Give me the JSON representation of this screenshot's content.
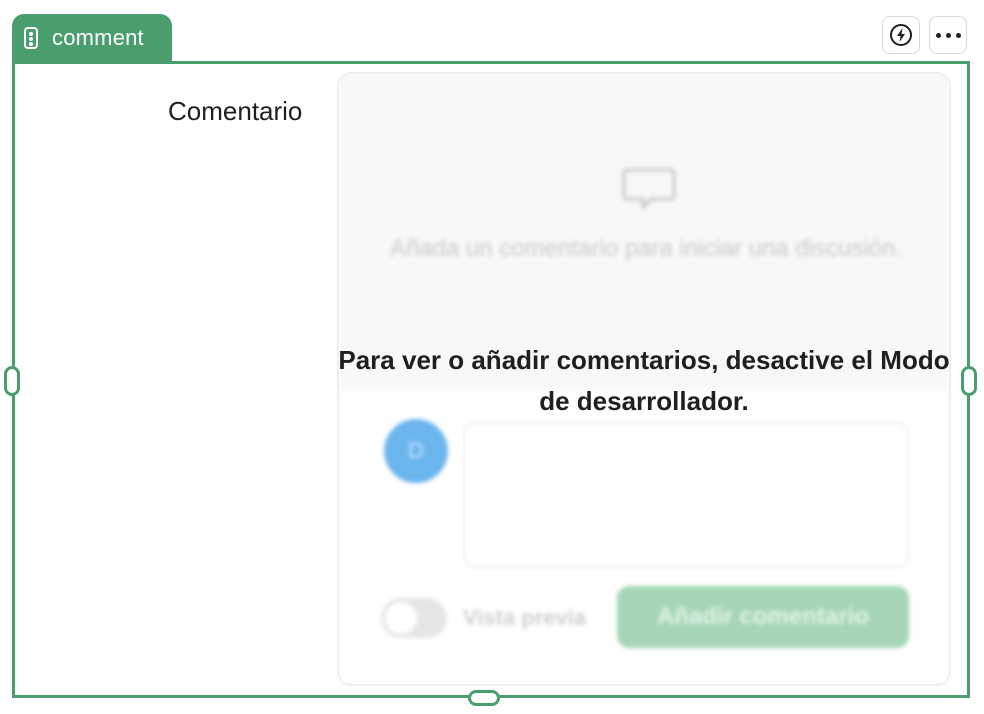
{
  "component": {
    "type_label": "comment",
    "field_label": "Comentario",
    "accent_color": "#4a9e6e"
  },
  "toolbar": {
    "icons": [
      "lightning-icon",
      "more-horizontal-icon"
    ]
  },
  "comments": {
    "empty_message": "Añada un comentario para iniciar una discusión.",
    "avatar_initial": "D",
    "comment_placeholder": "",
    "preview_label": "Vista previa",
    "add_button_label": "Añadir comentario"
  },
  "overlay": {
    "message": "Para ver o añadir comentarios, desactive el Modo de desarrollador."
  }
}
